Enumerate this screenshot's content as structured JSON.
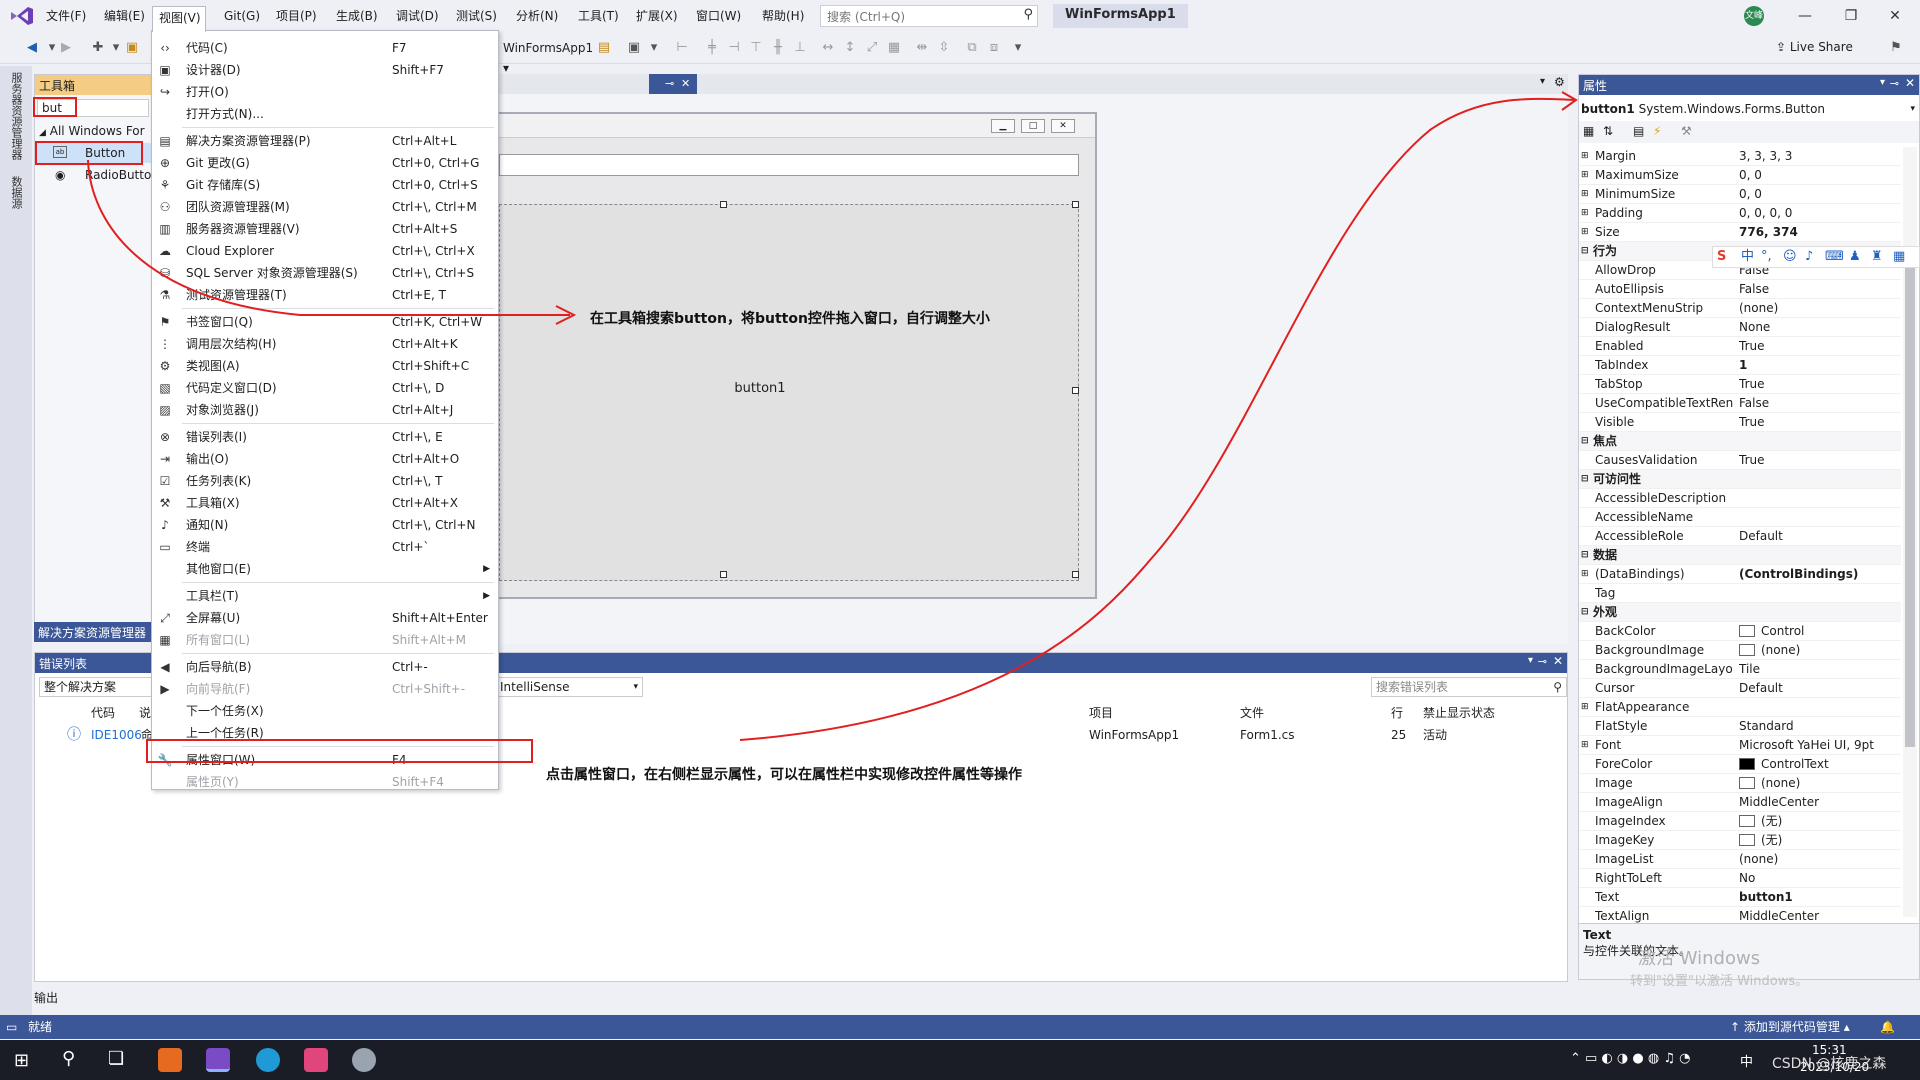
{
  "menubar": {
    "items": [
      "文件(F)",
      "编辑(E)",
      "视图(V)",
      "Git(G)",
      "项目(P)",
      "生成(B)",
      "调试(D)",
      "测试(S)",
      "分析(N)",
      "工具(T)",
      "扩展(X)",
      "窗口(W)",
      "帮助(H)"
    ],
    "search_placeholder": "搜索 (Ctrl+Q)",
    "app_title": "WinFormsApp1",
    "avatar_text": "文峰"
  },
  "toolbar": {
    "project": "WinFormsApp1",
    "live_share": "Live Share"
  },
  "toolbox": {
    "header": "工具箱",
    "search_value": "but",
    "group": "All Windows For",
    "items": [
      "Button",
      "RadioButto"
    ]
  },
  "left_strip": [
    "服务器资源管理器",
    "数据源"
  ],
  "solution_tab": "解决方案资源管理器",
  "form": {
    "button_label": "button1"
  },
  "view_menu": {
    "items": [
      {
        "label": "代码(C)",
        "shortcut": "F7",
        "icon": "code-icon"
      },
      {
        "label": "设计器(D)",
        "shortcut": "Shift+F7",
        "icon": "designer-icon"
      },
      {
        "label": "打开(O)",
        "shortcut": "",
        "icon": "open-icon"
      },
      {
        "label": "打开方式(N)...",
        "shortcut": "",
        "icon": ""
      },
      {
        "label": "解决方案资源管理器(P)",
        "shortcut": "Ctrl+Alt+L",
        "icon": "solution-icon"
      },
      {
        "label": "Git 更改(G)",
        "shortcut": "Ctrl+0, Ctrl+G",
        "icon": "git-changes-icon"
      },
      {
        "label": "Git 存储库(S)",
        "shortcut": "Ctrl+0, Ctrl+S",
        "icon": "git-repo-icon"
      },
      {
        "label": "团队资源管理器(M)",
        "shortcut": "Ctrl+\\, Ctrl+M",
        "icon": "team-icon"
      },
      {
        "label": "服务器资源管理器(V)",
        "shortcut": "Ctrl+Alt+S",
        "icon": "server-icon"
      },
      {
        "label": "Cloud Explorer",
        "shortcut": "Ctrl+\\, Ctrl+X",
        "icon": "cloud-icon"
      },
      {
        "label": "SQL Server 对象资源管理器(S)",
        "shortcut": "Ctrl+\\, Ctrl+S",
        "icon": "sql-icon"
      },
      {
        "label": "测试资源管理器(T)",
        "shortcut": "Ctrl+E, T",
        "icon": "test-icon"
      },
      {
        "label": "书签窗口(Q)",
        "shortcut": "Ctrl+K, Ctrl+W",
        "icon": "bookmark-icon"
      },
      {
        "label": "调用层次结构(H)",
        "shortcut": "Ctrl+Alt+K",
        "icon": "hierarchy-icon"
      },
      {
        "label": "类视图(A)",
        "shortcut": "Ctrl+Shift+C",
        "icon": "class-view-icon"
      },
      {
        "label": "代码定义窗口(D)",
        "shortcut": "Ctrl+\\, D",
        "icon": "code-def-icon"
      },
      {
        "label": "对象浏览器(J)",
        "shortcut": "Ctrl+Alt+J",
        "icon": "object-browser-icon"
      },
      {
        "label": "错误列表(I)",
        "shortcut": "Ctrl+\\, E",
        "icon": "error-list-icon"
      },
      {
        "label": "输出(O)",
        "shortcut": "Ctrl+Alt+O",
        "icon": "output-icon"
      },
      {
        "label": "任务列表(K)",
        "shortcut": "Ctrl+\\, T",
        "icon": "task-list-icon"
      },
      {
        "label": "工具箱(X)",
        "shortcut": "Ctrl+Alt+X",
        "icon": "toolbox-icon"
      },
      {
        "label": "通知(N)",
        "shortcut": "Ctrl+\\, Ctrl+N",
        "icon": "bell-icon"
      },
      {
        "label": "终端",
        "shortcut": "Ctrl+`",
        "icon": "terminal-icon"
      },
      {
        "label": "其他窗口(E)",
        "shortcut": "",
        "icon": ""
      },
      {
        "label": "工具栏(T)",
        "shortcut": "",
        "icon": ""
      },
      {
        "label": "全屏幕(U)",
        "shortcut": "Shift+Alt+Enter",
        "icon": "fullscreen-icon"
      },
      {
        "label": "所有窗口(L)",
        "shortcut": "Shift+Alt+M",
        "icon": "all-windows-icon"
      },
      {
        "label": "向后导航(B)",
        "shortcut": "Ctrl+-",
        "icon": "back-icon"
      },
      {
        "label": "向前导航(F)",
        "shortcut": "Ctrl+Shift+-",
        "icon": "forward-icon"
      },
      {
        "label": "下一个任务(X)",
        "shortcut": "",
        "icon": ""
      },
      {
        "label": "上一个任务(R)",
        "shortcut": "",
        "icon": ""
      },
      {
        "label": "属性窗口(W)",
        "shortcut": "F4",
        "icon": "wrench-icon"
      },
      {
        "label": "属性页(Y)",
        "shortcut": "Shift+F4",
        "icon": ""
      }
    ]
  },
  "error_list": {
    "header": "错误列表",
    "filter": "整个解决方案",
    "intellisense": "IntelliSense",
    "search_placeholder": "搜索错误列表",
    "columns": [
      "代码",
      "说",
      "项目",
      "文件",
      "行",
      "禁止显示状态"
    ],
    "row": {
      "code": "IDE1006",
      "desc_fragment": "命",
      "project": "WinFormsApp1",
      "file": "Form1.cs",
      "line": "25",
      "state": "活动"
    }
  },
  "output_tab": "输出",
  "properties": {
    "header": "属性",
    "object_name": "button1",
    "object_type": "System.Windows.Forms.Button",
    "rows": [
      {
        "name": "Margin",
        "value": "3, 3, 3, 3",
        "cat": false,
        "exp": true
      },
      {
        "name": "MaximumSize",
        "value": "0, 0",
        "cat": false,
        "exp": true
      },
      {
        "name": "MinimumSize",
        "value": "0, 0",
        "cat": false,
        "exp": true
      },
      {
        "name": "Padding",
        "value": "0, 0, 0, 0",
        "cat": false,
        "exp": true
      },
      {
        "name": "Size",
        "value": "776, 374",
        "cat": false,
        "exp": true,
        "bold": true
      },
      {
        "name": "行为",
        "value": "",
        "cat": true
      },
      {
        "name": "AllowDrop",
        "value": "False",
        "cat": false
      },
      {
        "name": "AutoEllipsis",
        "value": "False",
        "cat": false
      },
      {
        "name": "ContextMenuStrip",
        "value": "(none)",
        "cat": false
      },
      {
        "name": "DialogResult",
        "value": "None",
        "cat": false
      },
      {
        "name": "Enabled",
        "value": "True",
        "cat": false
      },
      {
        "name": "TabIndex",
        "value": "1",
        "cat": false,
        "bold": true
      },
      {
        "name": "TabStop",
        "value": "True",
        "cat": false
      },
      {
        "name": "UseCompatibleTextRen",
        "value": "False",
        "cat": false
      },
      {
        "name": "Visible",
        "value": "True",
        "cat": false
      },
      {
        "name": "焦点",
        "value": "",
        "cat": true
      },
      {
        "name": "CausesValidation",
        "value": "True",
        "cat": false
      },
      {
        "name": "可访问性",
        "value": "",
        "cat": true
      },
      {
        "name": "AccessibleDescription",
        "value": "",
        "cat": false
      },
      {
        "name": "AccessibleName",
        "value": "",
        "cat": false
      },
      {
        "name": "AccessibleRole",
        "value": "Default",
        "cat": false
      },
      {
        "name": "数据",
        "value": "",
        "cat": true
      },
      {
        "name": "(DataBindings)",
        "value": "(ControlBindings)",
        "cat": false,
        "exp": true,
        "bold": true
      },
      {
        "name": "Tag",
        "value": "",
        "cat": false
      },
      {
        "name": "外观",
        "value": "",
        "cat": true
      },
      {
        "name": "BackColor",
        "value": "Control",
        "cat": false,
        "swatch": "#ffffff"
      },
      {
        "name": "BackgroundImage",
        "value": "(none)",
        "cat": false,
        "swatch": "#ffffff"
      },
      {
        "name": "BackgroundImageLayo",
        "value": "Tile",
        "cat": false
      },
      {
        "name": "Cursor",
        "value": "Default",
        "cat": false
      },
      {
        "name": "FlatAppearance",
        "value": "",
        "cat": false,
        "exp": true
      },
      {
        "name": "FlatStyle",
        "value": "Standard",
        "cat": false
      },
      {
        "name": "Font",
        "value": "Microsoft YaHei UI, 9pt",
        "cat": false,
        "exp": true
      },
      {
        "name": "ForeColor",
        "value": "ControlText",
        "cat": false,
        "swatch": "#000000"
      },
      {
        "name": "Image",
        "value": "(none)",
        "cat": false,
        "swatch": "#ffffff"
      },
      {
        "name": "ImageAlign",
        "value": "MiddleCenter",
        "cat": false
      },
      {
        "name": "ImageIndex",
        "value": "(无)",
        "cat": false,
        "swatch": "#ffffff"
      },
      {
        "name": "ImageKey",
        "value": "(无)",
        "cat": false,
        "swatch": "#ffffff"
      },
      {
        "name": "ImageList",
        "value": "(none)",
        "cat": false
      },
      {
        "name": "RightToLeft",
        "value": "No",
        "cat": false
      },
      {
        "name": "Text",
        "value": "button1",
        "cat": false,
        "bold": true
      },
      {
        "name": "TextAlign",
        "value": "MiddleCenter",
        "cat": false
      }
    ],
    "desc_title": "Text",
    "desc_text": "与控件关联的文本。"
  },
  "statusbar": {
    "ready": "就绪",
    "source_control": "添加到源代码管理"
  },
  "taskbar": {
    "time": "15:31",
    "date": "2023/10/20",
    "ime": "中"
  },
  "annotations": {
    "note1": "在工具箱搜索button，将button控件拖入窗口，自行调整大小",
    "note2": "点击属性窗口，在右侧栏显示属性，可以在属性栏中实现修改控件属性等操作"
  },
  "watermark": {
    "line1": "激活 Windows",
    "line2": "转到\"设置\"以激活 Windows。",
    "csdn": "CSDN @核鹿之森"
  },
  "colors": {
    "accent": "#3c5797",
    "toolbox_header": "#f5cc84",
    "annotation": "#e02020"
  }
}
